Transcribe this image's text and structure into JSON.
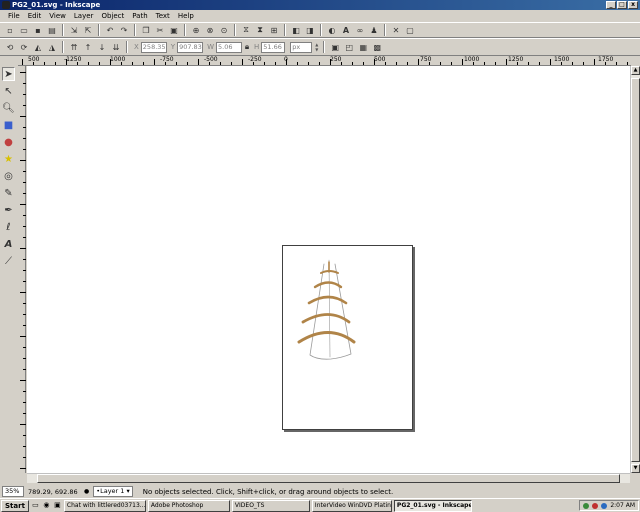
{
  "window": {
    "title": "PG2_01.svg - Inkscape"
  },
  "menu": [
    "File",
    "Edit",
    "View",
    "Layer",
    "Object",
    "Path",
    "Text",
    "Help"
  ],
  "toolbar1": {
    "icons": [
      "new-icon",
      "open-icon",
      "save-icon",
      "print-icon",
      "import-icon",
      "export-icon",
      "undo-icon",
      "redo-icon",
      "copy-icon",
      "cut-icon",
      "paste-icon",
      "zoom-selection-icon",
      "zoom-drawing-icon",
      "zoom-page-icon",
      "duplicate-icon",
      "clone-icon",
      "unlink-clone-icon",
      "group-icon",
      "ungroup-icon",
      "fill-stroke-icon",
      "text-font-icon",
      "xml-editor-icon",
      "align-icon",
      "preferences-icon",
      "document-properties-icon"
    ]
  },
  "toolbar2": {
    "x_label": "X",
    "x_value": "258.35",
    "y_label": "Y",
    "y_value": "907.83",
    "w_label": "W",
    "w_value": "5.06",
    "h_label": "H",
    "h_value": "51.66",
    "units": "px"
  },
  "ruler": {
    "labels": [
      "500",
      "-1250",
      "1000",
      "-750",
      "-500",
      "-250",
      "0",
      "250",
      "500",
      "750",
      "1000",
      "1250",
      "1500",
      "1750"
    ]
  },
  "status": {
    "zoom": "35%",
    "coords": "789.29, 692.86",
    "layer": "•Layer 1",
    "message": "No objects selected. Click, Shift+click, or drag around objects to select."
  },
  "taskbar": {
    "start": "Start",
    "tasks": [
      "Chat with littlered03713...",
      "Adobe Photoshop",
      "VIDEO_TS",
      "InterVideo WinDVD Platinum",
      "PG2_01.svg - Inkscape"
    ],
    "clock": "2:07 AM"
  },
  "colors": {
    "stroke_brown": "#b08448",
    "stroke_grey": "#9a9a9a"
  }
}
